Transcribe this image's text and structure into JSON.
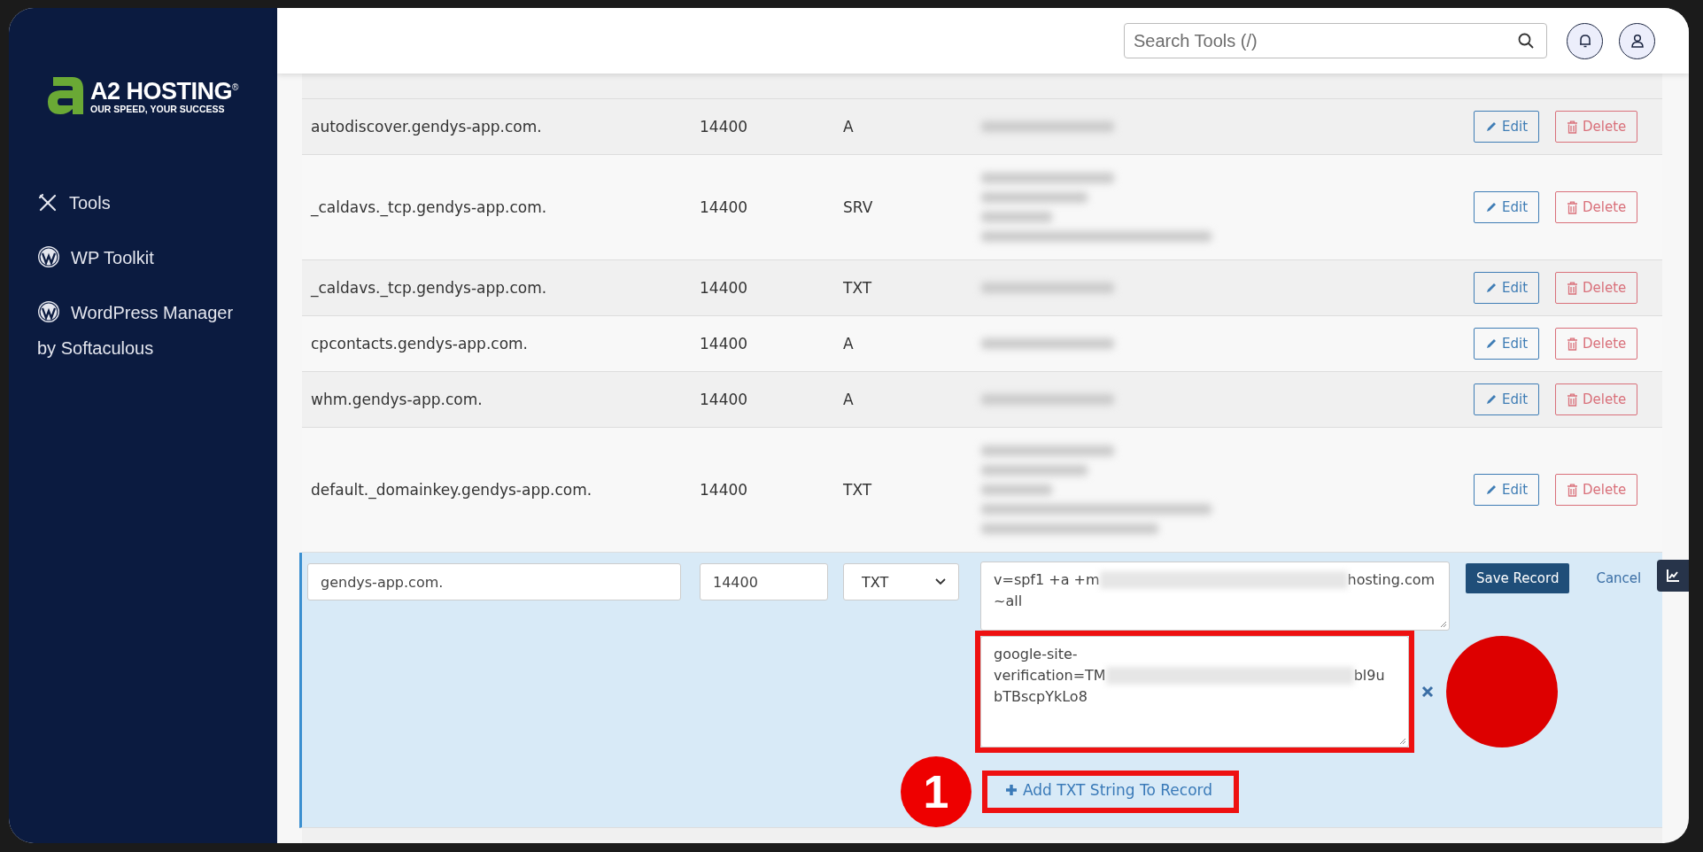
{
  "sidebar": {
    "logo": {
      "brand": "A2 HOSTING",
      "registered": "®",
      "tagline": "OUR SPEED, YOUR SUCCESS"
    },
    "items": [
      {
        "label": "Tools",
        "kind": "tools"
      },
      {
        "label": "WP Toolkit",
        "kind": "wordpress"
      },
      {
        "label": "WordPress Manager by Softaculous",
        "kind": "wordpress"
      }
    ]
  },
  "header": {
    "search": {
      "placeholder": "Search Tools (/)"
    }
  },
  "records": [
    {
      "name": "autodiscover.gendys-app.com.",
      "ttl": "14400",
      "type": "A",
      "record_lines": [
        {
          "redacted": true
        }
      ],
      "edit": "Edit",
      "delete": "Delete"
    },
    {
      "name": "_caldavs._tcp.gendys-app.com.",
      "ttl": "14400",
      "type": "SRV",
      "record_lines": [
        {
          "redacted": true
        },
        {
          "redacted": true
        },
        {
          "redacted": true
        },
        {
          "redacted": true
        }
      ],
      "edit": "Edit",
      "delete": "Delete"
    },
    {
      "name": "_caldavs._tcp.gendys-app.com.",
      "ttl": "14400",
      "type": "TXT",
      "record_lines": [
        {
          "redacted": true
        }
      ],
      "edit": "Edit",
      "delete": "Delete"
    },
    {
      "name": "cpcontacts.gendys-app.com.",
      "ttl": "14400",
      "type": "A",
      "record_lines": [
        {
          "redacted": true
        }
      ],
      "edit": "Edit",
      "delete": "Delete"
    },
    {
      "name": "whm.gendys-app.com.",
      "ttl": "14400",
      "type": "A",
      "record_lines": [
        {
          "redacted": true
        }
      ],
      "edit": "Edit",
      "delete": "Delete"
    },
    {
      "name": "default._domainkey.gendys-app.com.",
      "ttl": "14400",
      "type": "TXT",
      "record_lines": [
        {
          "redacted": true
        },
        {
          "redacted": true
        },
        {
          "redacted": true
        },
        {
          "redacted": true
        },
        {
          "redacted": true
        }
      ],
      "edit": "Edit",
      "delete": "Delete"
    }
  ],
  "edit_row": {
    "name_value": "gendys-app.com.",
    "ttl_value": "14400",
    "type_value": "TXT",
    "txt_strings": [
      {
        "highlighted": false,
        "removable": false,
        "lines": [
          [
            {
              "text": "v=spf1 +a +m"
            },
            {
              "redacted": true
            },
            {
              "text": "hosting.com"
            }
          ],
          [
            {
              "text": "~all"
            }
          ]
        ]
      },
      {
        "highlighted": true,
        "removable": true,
        "lines": [
          [
            {
              "text": "google-site-"
            }
          ],
          [
            {
              "text": "verification=TM"
            },
            {
              "redacted": true
            },
            {
              "text": "bl9u"
            }
          ],
          [
            {
              "text": "bTBscpYkLo8"
            }
          ]
        ]
      }
    ],
    "add_string": {
      "label": "Add TXT String To Record",
      "highlighted": true,
      "marker": "1"
    },
    "save_button": "Save Record",
    "cancel_link": "Cancel"
  }
}
